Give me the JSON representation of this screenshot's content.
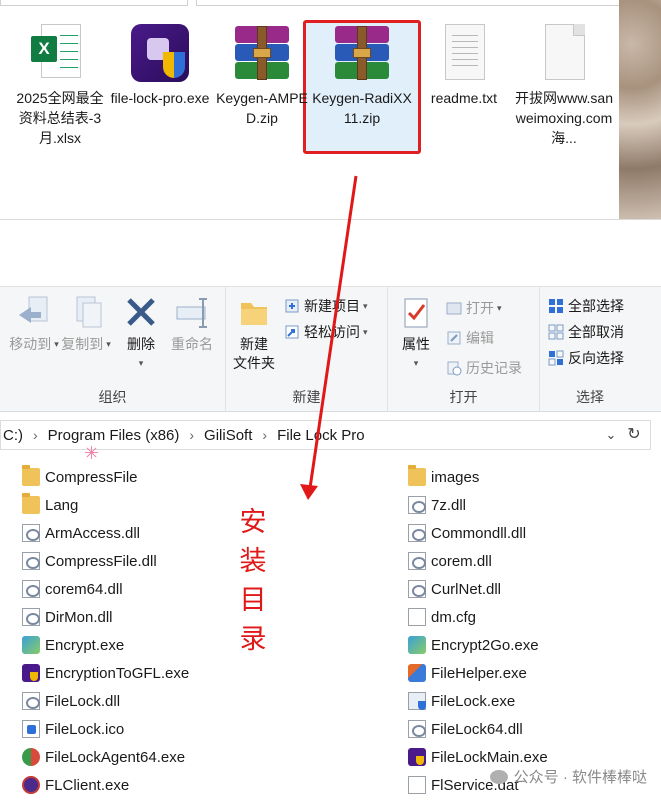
{
  "top_files": [
    {
      "label": "2025全网最全资料总结表-3月.xlsx",
      "icon": "excel-file-icon"
    },
    {
      "label": "file-lock-pro.exe",
      "icon": "filelock-app-icon"
    },
    {
      "label": "Keygen-AMPED.zip",
      "icon": "winrar-archive-icon"
    },
    {
      "label": "Keygen-RadiXX11.zip",
      "icon": "winrar-archive-icon",
      "selected": true
    },
    {
      "label": "readme.txt",
      "icon": "text-file-icon"
    },
    {
      "label": "开拔网www.sanweimoxing.com 海...",
      "icon": "blank-file-icon"
    }
  ],
  "ribbon": {
    "organize": {
      "title": "组织",
      "move_to": "移动到",
      "copy_to": "复制到",
      "delete": "删除",
      "rename": "重命名"
    },
    "new": {
      "title": "新建",
      "new_folder": "新建\n文件夹",
      "new_item": "新建项目",
      "easy_access": "轻松访问"
    },
    "open": {
      "title": "打开",
      "properties": "属性",
      "open": "打开",
      "edit": "编辑",
      "history": "历史记录"
    },
    "select": {
      "title": "选择",
      "select_all": "全部选择",
      "select_none": "全部取消",
      "invert": "反向选择"
    }
  },
  "address": {
    "crumbs": [
      "C:)",
      "Program Files (x86)",
      "GiliSoft",
      "File Lock Pro"
    ]
  },
  "files_left": [
    {
      "name": "CompressFile",
      "type": "folder"
    },
    {
      "name": "Lang",
      "type": "folder"
    },
    {
      "name": "ArmAccess.dll",
      "type": "dll"
    },
    {
      "name": "CompressFile.dll",
      "type": "dll"
    },
    {
      "name": "corem64.dll",
      "type": "dll"
    },
    {
      "name": "DirMon.dll",
      "type": "dll"
    },
    {
      "name": "Encrypt.exe",
      "type": "exe-enc"
    },
    {
      "name": "EncryptionToGFL.exe",
      "type": "exe-purple"
    },
    {
      "name": "FileLock.dll",
      "type": "dll"
    },
    {
      "name": "FileLock.ico",
      "type": "ico"
    },
    {
      "name": "FileLockAgent64.exe",
      "type": "agent"
    },
    {
      "name": "FLClient.exe",
      "type": "flclient"
    }
  ],
  "files_right": [
    {
      "name": "images",
      "type": "folder"
    },
    {
      "name": "7z.dll",
      "type": "dll"
    },
    {
      "name": "Commondll.dll",
      "type": "dll"
    },
    {
      "name": "corem.dll",
      "type": "dll"
    },
    {
      "name": "CurlNet.dll",
      "type": "dll"
    },
    {
      "name": "dm.cfg",
      "type": "file"
    },
    {
      "name": "Encrypt2Go.exe",
      "type": "exe-enc"
    },
    {
      "name": "FileHelper.exe",
      "type": "exe-helper"
    },
    {
      "name": "FileLock.exe",
      "type": "exe-lock"
    },
    {
      "name": "FileLock64.dll",
      "type": "dll"
    },
    {
      "name": "FileLockMain.exe",
      "type": "exe-purple"
    },
    {
      "name": "FlService.dat",
      "type": "file"
    }
  ],
  "annotation": {
    "text": "安装目录",
    "color": "#e01818"
  },
  "watermark": "公众号 · 软件棒棒哒"
}
